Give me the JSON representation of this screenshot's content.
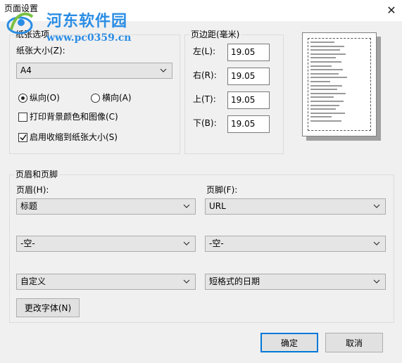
{
  "window": {
    "title": "页面设置",
    "close_glyph": "✕"
  },
  "watermark": {
    "title": "河东软件园",
    "url": "www.pc0359.cn"
  },
  "paper": {
    "group_title": "纸张选项",
    "size_label": "纸张大小(Z):",
    "size_value": "A4",
    "portrait_label": "纵向(O)",
    "landscape_label": "横向(A)",
    "orientation": "portrait",
    "print_bg_label": "打印背景颜色和图像(C)",
    "print_bg_checked": false,
    "shrink_label": "启用收缩到纸张大小(S)",
    "shrink_checked": true
  },
  "margins": {
    "group_title": "页边距(毫米)",
    "left_label": "左(L):",
    "left_value": "19.05",
    "right_label": "右(R):",
    "right_value": "19.05",
    "top_label": "上(T):",
    "top_value": "19.05",
    "bottom_label": "下(B):",
    "bottom_value": "19.05"
  },
  "header_footer": {
    "group_title": "页眉和页脚",
    "header_label": "页眉(H):",
    "footer_label": "页脚(F):",
    "header_values": [
      "标题",
      "-空-",
      "自定义"
    ],
    "footer_values": [
      "URL",
      "-空-",
      "短格式的日期"
    ],
    "change_font_label": "更改字体(N)"
  },
  "buttons": {
    "ok_label": "确定",
    "cancel_label": "取消"
  }
}
